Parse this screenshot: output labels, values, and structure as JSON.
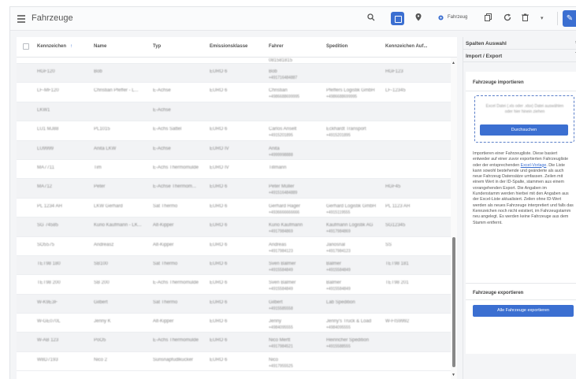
{
  "topbar": {
    "title": "Fahrzeuge",
    "vehicle_label": "Fahrzeug",
    "icons": [
      "menu-icon",
      "search-icon",
      "grid-view-icon",
      "pin-icon",
      "gear-icon",
      "copy-icon",
      "refresh-icon",
      "trash-icon",
      "chevron-down-icon",
      "wrench-icon"
    ]
  },
  "table": {
    "columns": [
      "Kennzeichen",
      "Name",
      "Typ",
      "Emissionsklasse",
      "Fahrer",
      "Spedition",
      "Kennzeichen Auf..."
    ],
    "sorted_column": "Kennzeichen",
    "first_row_fahrer": "081581815",
    "rows": [
      {
        "kennzeichen": "HGF120",
        "name": "Bob",
        "typ": "",
        "emission": "EURO 6",
        "fahrer": "Bob",
        "fahrer_sub": "+491716484887",
        "spedition": "",
        "aufl": "HGF123"
      },
      {
        "kennzeichen": "LF-MF120",
        "name": "Christian Pfeffer - L...",
        "typ": "E-Achse",
        "emission": "EURO 6",
        "fahrer": "Christian",
        "fahrer_sub": "+4986688699995",
        "spedition": "Pfeffers Logistik GmbH",
        "spedition_sub": "+4986688699995",
        "aufl": "LF-12345"
      },
      {
        "kennzeichen": "LKW1",
        "name": "",
        "typ": "E-Achse",
        "emission": "",
        "fahrer": "",
        "spedition": "",
        "aufl": ""
      },
      {
        "kennzeichen": "LU1 MJ88",
        "name": "PL1015",
        "typ": "E-Achs Sattel",
        "emission": "EURO 6",
        "fahrer": "Carlos Anselt",
        "fahrer_sub": "+4915201895",
        "spedition": "Eckhardt Transport",
        "spedition_sub": "+4915201895",
        "aufl": ""
      },
      {
        "kennzeichen": "LU9999",
        "name": "Anita LKW",
        "typ": "E-Achse",
        "emission": "EURO IV",
        "fahrer": "Anita",
        "fahrer_sub": "+4999998888",
        "spedition": "",
        "aufl": ""
      },
      {
        "kennzeichen": "MA7711",
        "name": "Tim",
        "typ": "E-Achs Thermomulde",
        "emission": "EURO IV",
        "fahrer": "Tillmann",
        "spedition": "",
        "aufl": ""
      },
      {
        "kennzeichen": "MA712",
        "name": "Peter",
        "typ": "E-Achse Thermom...",
        "emission": "EURO 6",
        "fahrer": "Peter Müller",
        "fahrer_sub": "+491516484889",
        "spedition": "",
        "aufl": "HGF45"
      },
      {
        "kennzeichen": "PL 1234 AH",
        "name": "LKW Gerhard",
        "typ": "Sat Thermo",
        "emission": "EURO 6",
        "fahrer": "Gerhard Hager",
        "fahrer_sub": "+4936666666666",
        "spedition": "Gerhard Logistik GmbH",
        "spedition_sub": "+4915119555",
        "aufl": "PL 1123 AH"
      },
      {
        "kennzeichen": "SG 74585",
        "name": "Kurio Kaufmann - LK...",
        "typ": "Alt-Kipper",
        "emission": "EURO 6",
        "fahrer": "Kurio Kaufmann",
        "fahrer_sub": "+4917984869",
        "spedition": "Kaufmann Logistik AG",
        "spedition_sub": "+4917984869",
        "aufl": "SG12345"
      },
      {
        "kennzeichen": "SO5575",
        "name": "Andreasz",
        "typ": "Alt-Kipper",
        "emission": "EURO 6",
        "fahrer": "Andreas",
        "fahrer_sub": "+4917984123",
        "spedition": "Janosnal",
        "spedition_sub": "+4917984123",
        "aufl": "SS"
      },
      {
        "kennzeichen": "TET98 180",
        "name": "SB100",
        "typ": "Sat Thermo",
        "emission": "EURO 6",
        "fahrer": "Sven Balmer",
        "fahrer_sub": "+4915584849",
        "spedition": "Balmer",
        "spedition_sub": "+4915584849",
        "aufl": "TET98 181"
      },
      {
        "kennzeichen": "TET98 200",
        "name": "SB 200",
        "typ": "E-Achs Thermomulde",
        "emission": "EURO 6",
        "fahrer": "Sven Balmer",
        "fahrer_sub": "+4915584849",
        "spedition": "Balmer",
        "spedition_sub": "+4915584849",
        "aufl": "TET98 201"
      },
      {
        "kennzeichen": "W-K9E3F",
        "name": "Gilbert",
        "typ": "Sat Thermo",
        "emission": "EURO 6",
        "fahrer": "Gilbert",
        "fahrer_sub": "+4915585558",
        "spedition": "Lab Spedition",
        "aufl": ""
      },
      {
        "kennzeichen": "W-GE070L",
        "name": "Jenny K",
        "typ": "Alt-Kipper",
        "emission": "EURO 6",
        "fahrer": "Jenny",
        "fahrer_sub": "+4984095555",
        "spedition": "Jenny's Truck & Load",
        "spedition_sub": "+4984095555",
        "aufl": "W-FIS9992"
      },
      {
        "kennzeichen": "W-AB 123",
        "name": "PoO5",
        "typ": "E-Achs Thermomulde",
        "emission": "EURO 6",
        "fahrer": "Nico Mertt",
        "fahrer_sub": "+4917984521",
        "spedition": "Heinricher Spedition",
        "spedition_sub": "+4915588555",
        "aufl": ""
      },
      {
        "kennzeichen": "W8D7193",
        "name": "Nico 2",
        "typ": "Sunsnapfudlkucker",
        "emission": "EURO 6",
        "fahrer": "Nico",
        "fahrer_sub": "+4917955525",
        "spedition": "",
        "aufl": ""
      }
    ]
  },
  "side_panel": {
    "section_columns": "Spalten Auswahl",
    "section_import_export": "Import / Export",
    "import_title": "Fahrzeuge importieren",
    "dropzone_text": "Excel Datei (.xls oder .xlsx) Datei auswählen oder hier hinein ziehen",
    "browse_button": "Durchsuchen",
    "desc_part1": "Importieren einer Fahrzeugliste. Diese basiert entweder auf einer zuvor exportierten Fahrzeugliste oder der entsprechenden ",
    "desc_link": "Excel-Vorlage",
    "desc_part2": ". Die Liste kann sowohl bestehende und geänderte als auch neue Fahrzeug Datensätze umfassen. Zeilen mit einem Wert in der ID-Spalte, stammen aus einem vorangehenden Export. Die Angaben im Kundenstamm werden hierbei mit den Angaben aus der Excel-Liste aktualisiert. Zeilen ohne ID-Wert werden als neues Fahrzeuge interpretiert und falls das Kennzeichen noch nicht existiert, im Fahrzeugstamm neu angelegt. Es werden keine Fahrzeuge aus dem Stamm entfernt.",
    "export_title": "Fahrzeuge exportieren",
    "export_button": "Alle Fahrzeuge exportieren"
  }
}
